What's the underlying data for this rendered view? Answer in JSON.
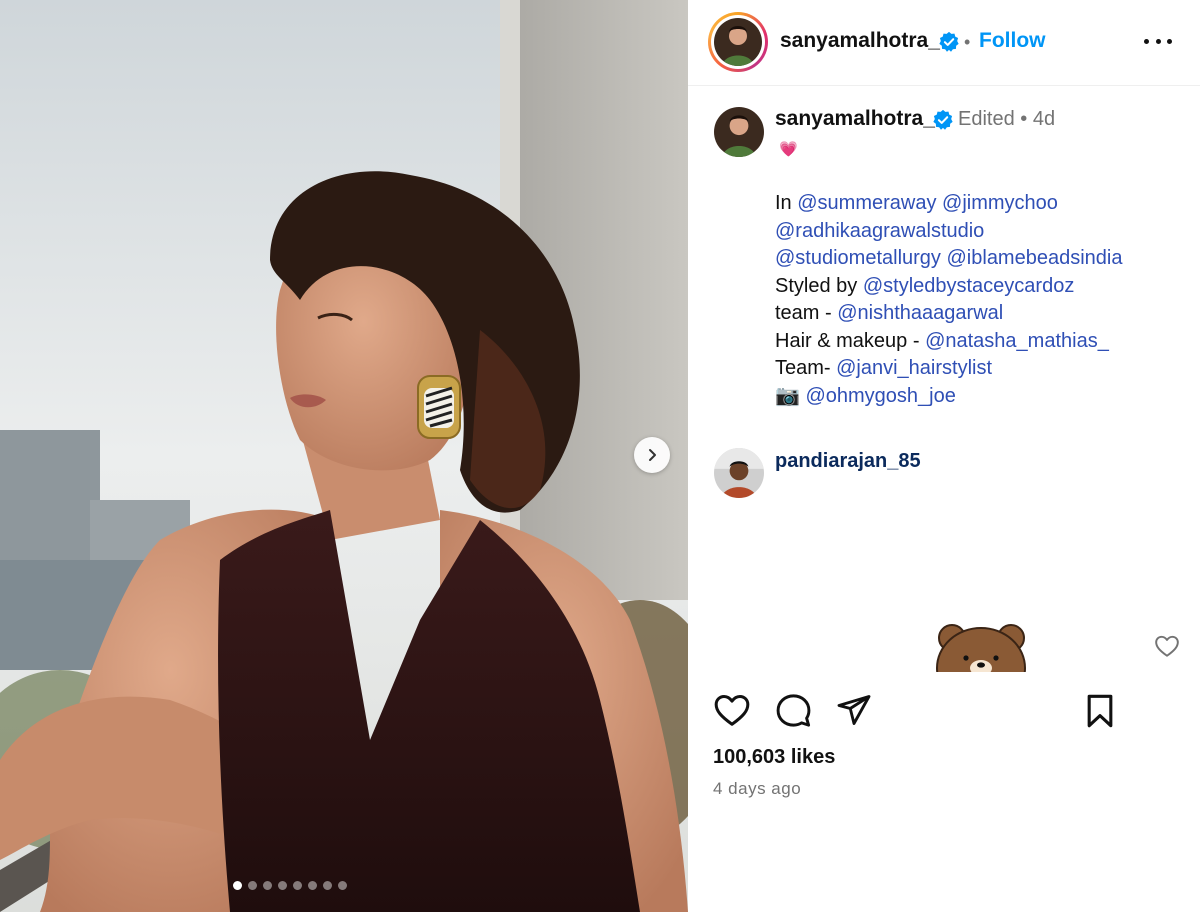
{
  "post": {
    "username": "sanyamalhotra_",
    "follow_label": "Follow",
    "separator": "•",
    "slides_total": 8,
    "slide_active": 1
  },
  "caption": {
    "username": "sanyamalhotra_",
    "edited_meta": "Edited • 4d",
    "heart_emoji": "💗",
    "lines": [
      [
        {
          "t": "In ",
          "m": false
        },
        {
          "t": "@summeraway",
          "m": true
        },
        {
          "t": " ",
          "m": false
        },
        {
          "t": "@jimmychoo",
          "m": true
        }
      ],
      [
        {
          "t": "@radhikaagrawalstudio",
          "m": true
        }
      ],
      [
        {
          "t": "@studiometallurgy",
          "m": true
        },
        {
          "t": " ",
          "m": false
        },
        {
          "t": "@iblamebeadsindia",
          "m": true
        }
      ],
      [
        {
          "t": "Styled by ",
          "m": false
        },
        {
          "t": "@styledbystaceycardoz",
          "m": true
        }
      ],
      [
        {
          "t": "team - ",
          "m": false
        },
        {
          "t": "@nishthaaagarwal",
          "m": true
        }
      ],
      [
        {
          "t": "Hair & makeup - ",
          "m": false
        },
        {
          "t": "@natasha_mathias_",
          "m": true
        }
      ],
      [
        {
          "t": "Team- ",
          "m": false
        },
        {
          "t": "@janvi_hairstylist",
          "m": true
        }
      ],
      [
        {
          "t": "📷 ",
          "m": false
        },
        {
          "t": "@ohmygosh_joe",
          "m": true
        }
      ]
    ]
  },
  "comment": {
    "username": "pandiarajan_85",
    "sticker": "brown-bear-sticker"
  },
  "actions": {
    "icons": [
      "heart-icon",
      "comment-icon",
      "share-icon",
      "bookmark-icon"
    ]
  },
  "stats": {
    "likes": "100,603 likes",
    "posted": "4 days ago"
  },
  "colors": {
    "link": "#2f4fb5",
    "follow": "#0095f6",
    "verified": "#0095f6",
    "muted": "#737373"
  }
}
